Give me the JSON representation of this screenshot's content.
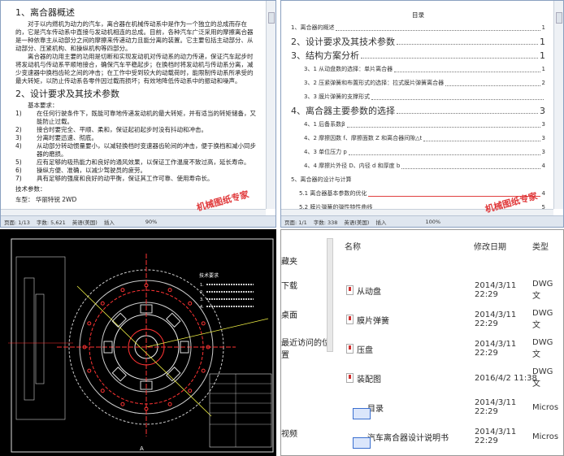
{
  "doc1": {
    "h1": "1、离合器概述",
    "p1": "对于以内燃机为动力的汽车，离合器在机械传动系中是作为一个独立的总成而存在的，它是汽车传动系中直接与发动机相连的总成。目前，各种汽车广泛采用的摩擦离合器是一种依靠主从动部分之间的摩擦来传递动力且能分离的装置。它主要包括主动部分、从动部分、压紧机构、和操纵机构等四部分。",
    "p2": "离合器的功用主要的功用是切断和实现发动机对传动系的动力传递，保证汽车起步时将发动机与传动系平顺地接合，确保汽车平稳起步；在换档时将发动机与传动系分离，减少变速器中换档齿轮之间的冲击；在工作中受到较大的动载荷时，能限制传动系所承受的最大转矩，以防止传动系各零件因过载而损坏；有效地降低传动系中的振动和噪声。",
    "h2": "2、设计要求及其技术参数",
    "basic": "基本要求：",
    "reqs": [
      {
        "n": "1)",
        "t": "在任何行驶条件下，既能可靠地传递发动机的最大转矩，并有适当的转矩储备，又能防止过载。"
      },
      {
        "n": "2)",
        "t": "接合时要完全、平顺、柔和，保证起初起步时没有抖动和冲击。"
      },
      {
        "n": "3)",
        "t": "分离时要迅速、彻底。"
      },
      {
        "n": "4)",
        "t": "从动部分转动惯量要小，以减轻换档时变速器齿轮间的冲击，便于换档和减小同步器的磨损。"
      },
      {
        "n": "5)",
        "t": "应有足够的吸热能力和良好的通风效果，以保证工作温度不致过高，延长寿命。"
      },
      {
        "n": "6)",
        "t": "操纵方便、准确，以减少驾驶员的疲劳。"
      },
      {
        "n": "7)",
        "t": "具有足够的强度和良好的动平衡，保证其工作可靠、使用寿命长。"
      }
    ],
    "tech": "技术参数：",
    "car": "车型：  华丽特锐 2WD",
    "status": {
      "page": "页面: 1/13",
      "words": "字数: 5,621",
      "lang": "英语(美国)",
      "mode": "插入",
      "zoom": "90%"
    },
    "watermark": "机械图纸专家"
  },
  "toc": {
    "title": "目录",
    "items": [
      {
        "t": "1、离合器的概述",
        "p": "1",
        "c": "sub0"
      },
      {
        "t": "2、设计要求及其技术参数",
        "p": "1",
        "c": "big"
      },
      {
        "t": "3、结构方案分析",
        "p": "1",
        "c": "big"
      },
      {
        "t": "3、1 从动盘数的选择：单片离合器",
        "p": "1",
        "c": "sub"
      },
      {
        "t": "3、2 压紧弹簧和布置形式的选择：拉式膜片弹簧离合器",
        "p": "2",
        "c": "sub"
      },
      {
        "t": "3、3 膜片弹簧的支撑形式",
        "p": "",
        "c": "sub"
      },
      {
        "t": "4、离合器主要参数的选择",
        "p": "3",
        "c": "big"
      },
      {
        "t": "4、1 后备系数β",
        "p": "3",
        "c": "sub"
      },
      {
        "t": "4、2 摩擦因数 f、摩擦面数 Z 和离合器间隙△t",
        "p": "3",
        "c": "sub"
      },
      {
        "t": "4、3 单位压力 p",
        "p": "3",
        "c": "sub"
      },
      {
        "t": "4、4 摩擦片外径 D、内径 d 和厚度 b",
        "p": "4",
        "c": "sub"
      },
      {
        "t": "5、离合器的设计与计算",
        "p": "",
        "c": "sec"
      },
      {
        "t": "5.1 离合器基本参数的优化",
        "p": "4",
        "c": "sub2 red"
      },
      {
        "t": "5.2 膜片弹簧的弹性特性曲线",
        "p": "5",
        "c": "sub2 red"
      },
      {
        "t": "5.3 膜片弹簧基本参数的选择",
        "p": "6",
        "c": "sub2 red"
      },
      {
        "t": "5.4 膜片弹簧的优化设计",
        "p": "7",
        "c": "sub2 red"
      }
    ],
    "status": {
      "page": "页面: 1/1",
      "words": "字数: 338",
      "lang": "英语(美国)",
      "mode": "插入",
      "zoom": "100%"
    },
    "watermark": "机械图纸专家"
  },
  "cad": {
    "tech_title": "技术要求",
    "tech_items": [
      "1.",
      "2.",
      "3.",
      "4."
    ],
    "label": "A"
  },
  "explorer": {
    "nav": [
      "藏夹",
      "下载",
      "桌面",
      "最近访问的位置",
      "视频"
    ],
    "headers": {
      "name": "名称",
      "date": "修改日期",
      "type": "类型"
    },
    "files": [
      {
        "name": "从动盘",
        "date": "2014/3/11 22:29",
        "type": "DWG 文",
        "icon": "dwg-file-icon"
      },
      {
        "name": "膜片弹簧",
        "date": "2014/3/11 22:29",
        "type": "DWG 文",
        "icon": "dwg-file-icon"
      },
      {
        "name": "压盘",
        "date": "2014/3/11 22:29",
        "type": "DWG 文",
        "icon": "dwg-file-icon"
      },
      {
        "name": "装配图",
        "date": "2016/4/2 11:38",
        "type": "DWG 文",
        "icon": "dwg-file-icon"
      },
      {
        "name": "目录",
        "date": "2014/3/11 22:29",
        "type": "Micros",
        "icon": "word-file-icon"
      },
      {
        "name": "汽车离合器设计说明书",
        "date": "2014/3/11 22:29",
        "type": "Micros",
        "icon": "word-file-icon"
      }
    ]
  }
}
